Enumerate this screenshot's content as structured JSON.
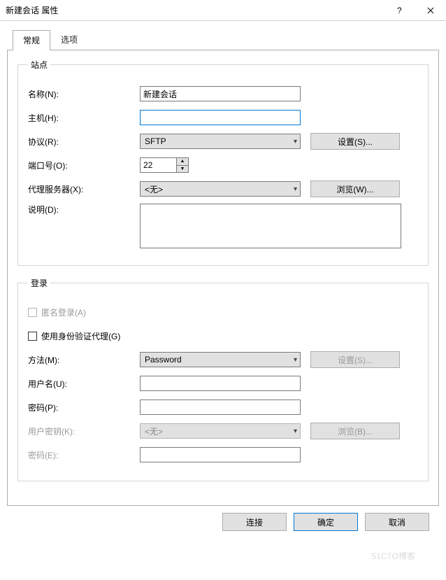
{
  "window": {
    "title": "新建会话 属性"
  },
  "tabs": {
    "general": "常规",
    "options": "选项"
  },
  "site": {
    "legend": "站点",
    "name_label": "名称(N):",
    "name_value": "新建会话",
    "host_label": "主机(H):",
    "host_value": "",
    "protocol_label": "协议(R):",
    "protocol_value": "SFTP",
    "settings_btn": "设置(S)...",
    "port_label": "端口号(O):",
    "port_value": "22",
    "proxy_label": "代理服务器(X):",
    "proxy_value": "<无>",
    "browse_btn": "浏览(W)...",
    "desc_label": "说明(D):",
    "desc_value": ""
  },
  "login": {
    "legend": "登录",
    "anon_label": "匿名登录(A)",
    "agent_label": "使用身份验证代理(G)",
    "method_label": "方法(M):",
    "method_value": "Password",
    "settings_btn": "设置(S)...",
    "user_label": "用户名(U):",
    "user_value": "",
    "pass_label": "密码(P):",
    "pass_value": "",
    "key_label": "用户密钥(K):",
    "key_value": "<无>",
    "browse_btn": "浏览(B)...",
    "keypass_label": "密码(E):",
    "keypass_value": ""
  },
  "buttons": {
    "connect": "连接",
    "ok": "确定",
    "cancel": "取消"
  },
  "watermark": "51CTO博客"
}
